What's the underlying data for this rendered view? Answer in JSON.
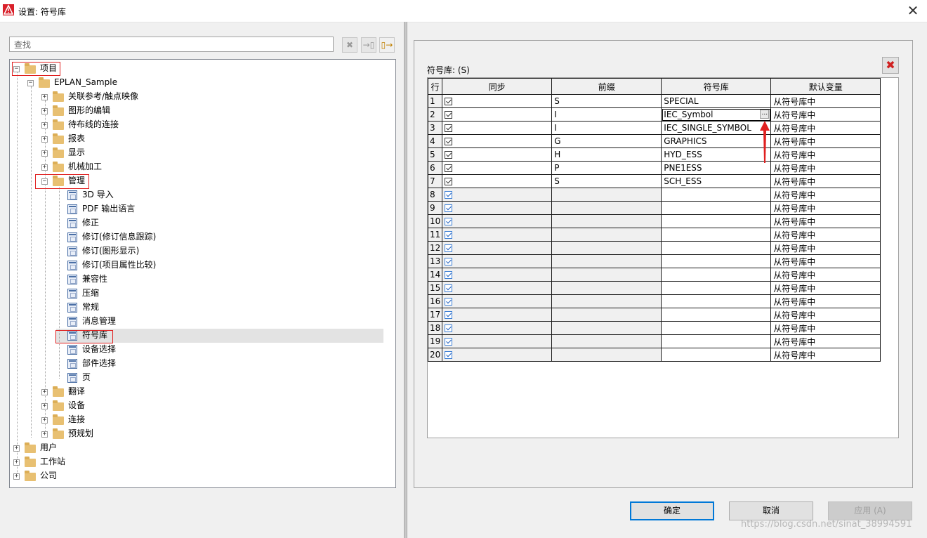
{
  "window": {
    "title": "设置: 符号库",
    "close_glyph": "✕"
  },
  "search": {
    "placeholder": "查找"
  },
  "tree": {
    "root_project": "项目",
    "project_name": "EPLAN_Sample",
    "project_children": [
      "关联参考/触点映像",
      "图形的编辑",
      "待布线的连接",
      "报表",
      "显示",
      "机械加工"
    ],
    "admin": "管理",
    "admin_children": [
      "3D 导入",
      "PDF 输出语言",
      "修正",
      "修订(修订信息跟踪)",
      "修订(图形显示)",
      "修订(项目属性比较)",
      "兼容性",
      "压缩",
      "常规",
      "消息管理",
      "符号库",
      "设备选择",
      "部件选择",
      "页"
    ],
    "after_admin": [
      "翻译",
      "设备",
      "连接",
      "预规划"
    ],
    "top_level": [
      "用户",
      "工作站",
      "公司"
    ]
  },
  "panel": {
    "label": "符号库: (S)",
    "delete_glyph": "✖"
  },
  "grid": {
    "headers": [
      "行",
      "同步",
      "前缀",
      "符号库",
      "默认变量"
    ],
    "rows": [
      {
        "n": "1",
        "prefix": "S",
        "lib": "SPECIAL",
        "var": "从符号库中"
      },
      {
        "n": "2",
        "prefix": "I",
        "lib": "IEC_Symbol",
        "var": "从符号库中"
      },
      {
        "n": "3",
        "prefix": "I",
        "lib": "IEC_SINGLE_SYMBOL",
        "var": "从符号库中"
      },
      {
        "n": "4",
        "prefix": "G",
        "lib": "GRAPHICS",
        "var": "从符号库中"
      },
      {
        "n": "5",
        "prefix": "H",
        "lib": "HYD_ESS",
        "var": "从符号库中"
      },
      {
        "n": "6",
        "prefix": "P",
        "lib": "PNE1ESS",
        "var": "从符号库中"
      },
      {
        "n": "7",
        "prefix": "S",
        "lib": "SCH_ESS",
        "var": "从符号库中"
      },
      {
        "n": "8",
        "prefix": "",
        "lib": "",
        "var": "从符号库中"
      },
      {
        "n": "9",
        "prefix": "",
        "lib": "",
        "var": "从符号库中"
      },
      {
        "n": "10",
        "prefix": "",
        "lib": "",
        "var": "从符号库中"
      },
      {
        "n": "11",
        "prefix": "",
        "lib": "",
        "var": "从符号库中"
      },
      {
        "n": "12",
        "prefix": "",
        "lib": "",
        "var": "从符号库中"
      },
      {
        "n": "13",
        "prefix": "",
        "lib": "",
        "var": "从符号库中"
      },
      {
        "n": "14",
        "prefix": "",
        "lib": "",
        "var": "从符号库中"
      },
      {
        "n": "15",
        "prefix": "",
        "lib": "",
        "var": "从符号库中"
      },
      {
        "n": "16",
        "prefix": "",
        "lib": "",
        "var": "从符号库中"
      },
      {
        "n": "17",
        "prefix": "",
        "lib": "",
        "var": "从符号库中"
      },
      {
        "n": "18",
        "prefix": "",
        "lib": "",
        "var": "从符号库中"
      },
      {
        "n": "19",
        "prefix": "",
        "lib": "",
        "var": "从符号库中"
      },
      {
        "n": "20",
        "prefix": "",
        "lib": "",
        "var": "从符号库中"
      }
    ],
    "ellipsis": "..."
  },
  "buttons": {
    "ok": "确定",
    "cancel": "取消",
    "apply": "应用 (A)"
  },
  "watermark": "https://blog.csdn.net/sinat_38994591",
  "colors": {
    "highlight_box": "#e02020",
    "primary_border": "#0078d7",
    "arrow": "#e02020"
  }
}
